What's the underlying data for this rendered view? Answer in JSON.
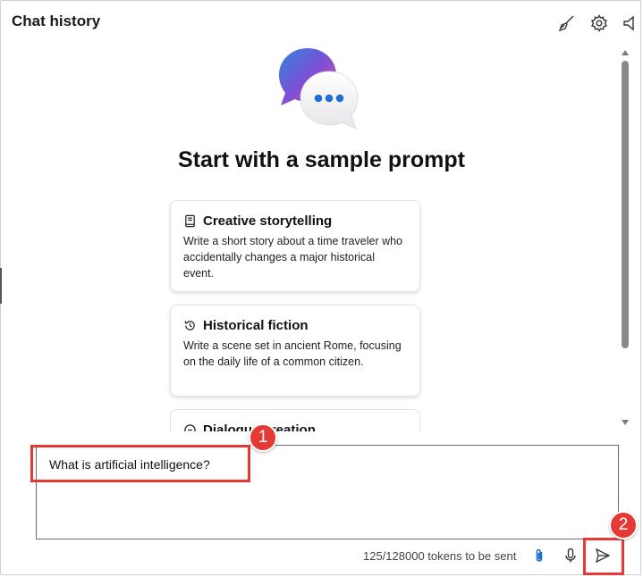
{
  "header": {
    "title": "Chat history",
    "icons": [
      "broom-icon",
      "gear-icon",
      "speaker-icon"
    ]
  },
  "hero": {
    "title": "Start with a sample prompt"
  },
  "cards": [
    {
      "title": "Creative storytelling",
      "icon": "book-icon",
      "description": "Write a short story about a time traveler who accidentally changes a major historical event."
    },
    {
      "title": "Historical fiction",
      "icon": "history-icon",
      "description": "Write a scene set in ancient Rome, focusing on the daily life of a common citizen."
    },
    {
      "title": "Dialogue creation",
      "icon": "chat-icon"
    }
  ],
  "input": {
    "value": "What is artificial intelligence?"
  },
  "footer": {
    "tokens": "125/128000 tokens to be sent",
    "icons": [
      "attach-icon",
      "microphone-icon",
      "send-icon"
    ]
  },
  "annotations": {
    "step1": "1",
    "step2": "2",
    "color": "#e53935"
  },
  "colors": {
    "logo_purple": "#7b4fd6",
    "logo_pink": "#e0559a",
    "logo_blue": "#2f86d8",
    "dots": "#1f6fd1"
  }
}
